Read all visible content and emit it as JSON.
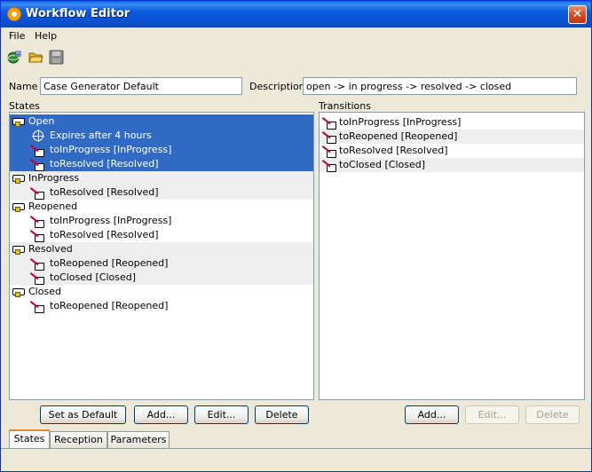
{
  "window": {
    "title": "Workflow Editor",
    "close_glyph": "✕"
  },
  "menu": {
    "items": [
      "File",
      "Help"
    ]
  },
  "toolbar": {
    "icons": [
      "new-workflow-icon",
      "open-folder-icon",
      "save-disk-icon"
    ]
  },
  "form": {
    "name_label": "Name",
    "name_value": "Case Generator Default",
    "description_label": "Description",
    "description_value": "open -> in progress -> resolved -> closed"
  },
  "states": {
    "label": "States",
    "rows": [
      {
        "kind": "state",
        "text": "Open",
        "level": 0
      },
      {
        "kind": "expire",
        "text": "Expires after 4 hours",
        "level": 1
      },
      {
        "kind": "transition",
        "text": "toInProgress [InProgress]",
        "level": 1
      },
      {
        "kind": "transition",
        "text": "toResolved [Resolved]",
        "level": 1
      },
      {
        "kind": "state",
        "text": "InProgress",
        "level": 0
      },
      {
        "kind": "transition",
        "text": "toResolved [Resolved]",
        "level": 1
      },
      {
        "kind": "state",
        "text": "Reopened",
        "level": 0
      },
      {
        "kind": "transition",
        "text": "toInProgress [InProgress]",
        "level": 1
      },
      {
        "kind": "transition",
        "text": "toResolved [Resolved]",
        "level": 1
      },
      {
        "kind": "state",
        "text": "Resolved",
        "level": 0
      },
      {
        "kind": "transition",
        "text": "toReopened [Reopened]",
        "level": 1
      },
      {
        "kind": "transition",
        "text": "toClosed [Closed]",
        "level": 1
      },
      {
        "kind": "state",
        "text": "Closed",
        "level": 0
      },
      {
        "kind": "transition",
        "text": "toReopened [Reopened]",
        "level": 1
      }
    ],
    "selected_state": "Open",
    "buttons": {
      "set_default": "Set as Default",
      "add": "Add...",
      "edit": "Edit...",
      "delete": "Delete"
    }
  },
  "transitions": {
    "label": "Transitions",
    "rows": [
      {
        "text": "toInProgress [InProgress]"
      },
      {
        "text": "toReopened [Reopened]"
      },
      {
        "text": "toResolved [Resolved]"
      },
      {
        "text": "toClosed [Closed]"
      }
    ],
    "buttons": {
      "add": "Add...",
      "edit": "Edit...",
      "delete": "Delete"
    }
  },
  "tabs": [
    {
      "label": "States",
      "active": true
    },
    {
      "label": "Reception",
      "active": false
    },
    {
      "label": "Parameters",
      "active": false
    }
  ],
  "colors": {
    "title_bar": "#0a5fd8",
    "selection": "#316ac5",
    "alt_row": "#eeeeee",
    "close_button": "#d4471f",
    "window_bg": "#ece9d8"
  }
}
